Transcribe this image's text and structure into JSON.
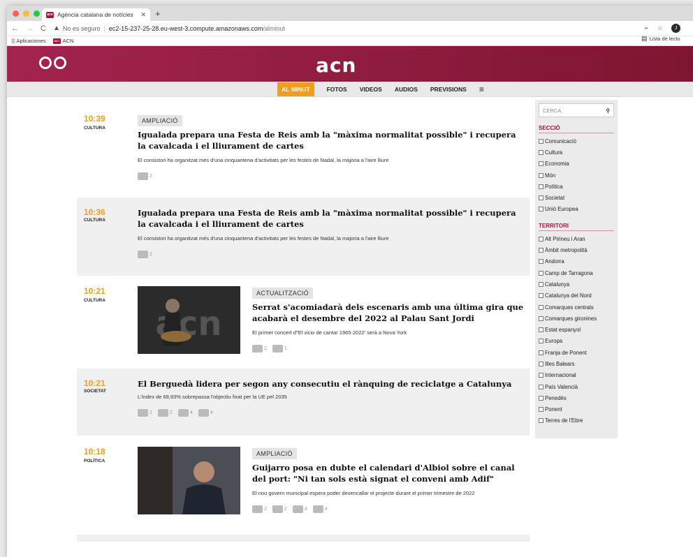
{
  "browser": {
    "tab_title": "Agència catalana de notícies",
    "favicon_text": "acn",
    "url_security": "No es seguro",
    "url_host": "ec2-15-237-25-28.eu-west-3.compute.amazonaws.com",
    "url_path": "/alminut",
    "avatar_letter": "J",
    "bookmarks": [
      {
        "label": "Aplicaciones"
      },
      {
        "label": "ACN"
      }
    ],
    "reading_list": "Lista de lectu"
  },
  "site": {
    "logo": "acn",
    "menu": [
      "AL MINUT",
      "FOTOS",
      "VIDEOS",
      "AUDIOS",
      "PREVISIONS",
      "≡"
    ]
  },
  "news": [
    {
      "time": "10:39",
      "section": "CULTURA",
      "badge": "AMPLIACIÓ",
      "title": "Igualada prepara una Festa de Reis amb la \"màxima normalitat possible\" i recupera la cavalcada i el lliurament de cartes",
      "desc": "El consistori ha organitzat més d'una cinquantena d'activitats per les festes de Nadal, la majoria a l'aire lliure",
      "text_count": "2"
    },
    {
      "time": "10:36",
      "section": "CULTURA",
      "title": "Igualada prepara una Festa de Reis amb la \"màxima normalitat possible\" i recupera la cavalcada i el lliurament de cartes",
      "desc": "El consistori ha organitzat més d'una cinquantena d'activitats per les festes de Nadal, la majoria a l'aire lliure",
      "text_count": "2"
    },
    {
      "time": "10:21",
      "section": "CULTURA",
      "badge": "ACTUALITZACIÓ",
      "title": "Serrat s'acomiadarà dels escenaris amb una última gira que acabarà el desembre del 2022 al Palau Sant Jordi",
      "desc": "El primer concert d\"El vicio de cantar 1965-2022' serà a Nova York",
      "text_count": "2",
      "photo_count": "1"
    },
    {
      "time": "10:21",
      "section": "SOCIETAT",
      "title": "El Berguedà lidera per segon any consecutiu el rànquing de reciclatge a Catalunya",
      "desc": "L'índex de 69,93% sobrepassa l'objectiu fixat per la UE pel 2035",
      "text_count": "2",
      "video_count": "2",
      "photo_count": "4",
      "audio_count": "4"
    },
    {
      "time": "10:18",
      "section": "POLÍTICA",
      "badge": "AMPLIACIÓ",
      "title": "Guijarro posa en dubte el calendari d'Albiol sobre el canal del port: \"Ni tan sols està signat el conveni amb Adif\"",
      "desc": "El nou govern municipal espera poder desencallar el projecte durant el primer trimestre de 2022",
      "text_count": "2",
      "video_count": "2",
      "photo_count": "4",
      "audio_count": "4"
    }
  ],
  "sidebar": {
    "search_placeholder": "CERCA",
    "seccio_title": "SECCIÓ",
    "seccio": [
      "Comunicació",
      "Cultura",
      "Economia",
      "Món",
      "Política",
      "Societat",
      "Unió Europea"
    ],
    "territori_title": "TERRITORI",
    "territori": [
      "Alt Pirineu i Aran",
      "Àmbit metropolità",
      "Andorra",
      "Camp de Tarragona",
      "Catalunya",
      "Catalunya del Nord",
      "Comarques centrals",
      "Comarques gironines",
      "Estat espanyol",
      "Europa",
      "Franja de Ponent",
      "Illes Balears",
      "Internacional",
      "País Valencià",
      "Penedès",
      "Ponent",
      "Terres de l'Ebre"
    ]
  },
  "colors": {
    "brand": "#a6193c",
    "accent": "#f29d1d"
  }
}
